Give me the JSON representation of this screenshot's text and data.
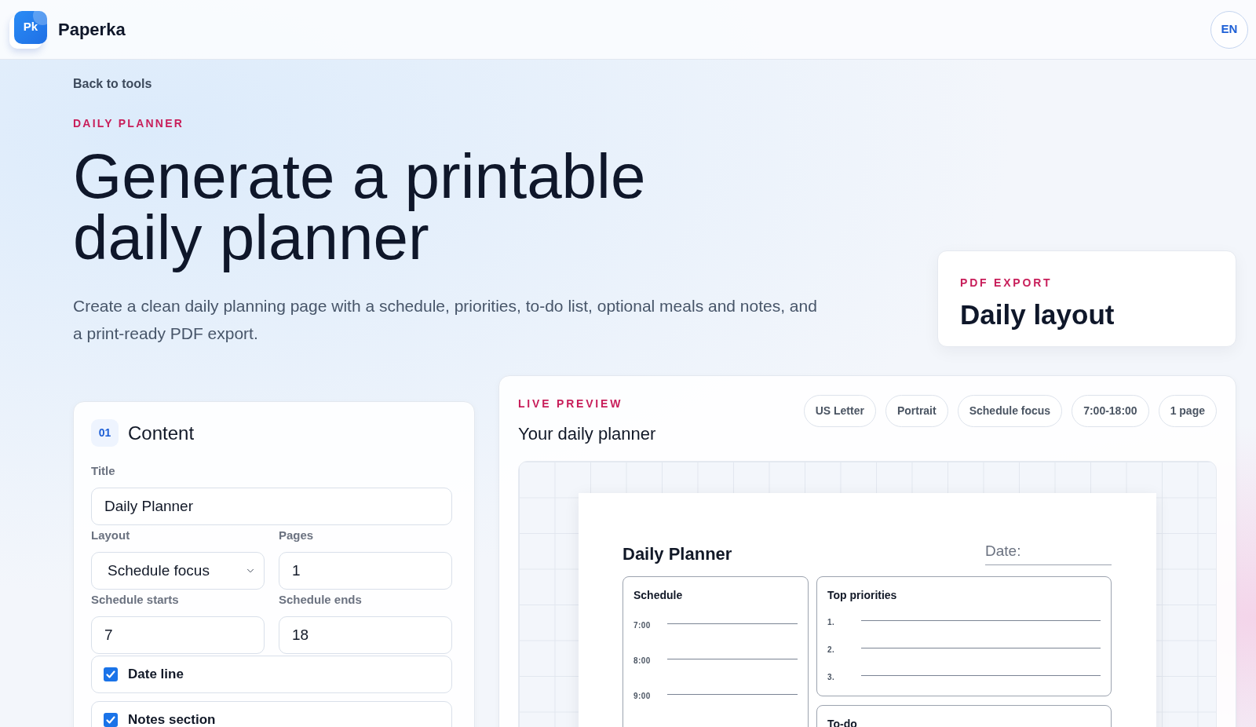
{
  "header": {
    "logo_text": "Pk",
    "brand": "Paperka",
    "language_button": "EN"
  },
  "hero": {
    "back_link": "Back to tools",
    "eyebrow": "DAILY PLANNER",
    "title": "Generate a printable daily planner",
    "description": "Create a clean daily planning page with a schedule, priorities, to-do list, optional meals and notes, and a print-ready PDF export."
  },
  "export_card": {
    "eyebrow": "PDF EXPORT",
    "title": "Daily layout"
  },
  "content_panel": {
    "step": "01",
    "title": "Content",
    "field_rows": [
      [
        {
          "kind": "text",
          "label": "Title",
          "value": "Daily Planner"
        }
      ],
      [
        {
          "kind": "select",
          "label": "Layout",
          "value": "Schedule focus"
        },
        {
          "kind": "number",
          "label": "Pages",
          "value": "1"
        }
      ],
      [
        {
          "kind": "number",
          "label": "Schedule starts",
          "value": "7"
        },
        {
          "kind": "number",
          "label": "Schedule ends",
          "value": "18"
        }
      ]
    ],
    "options": [
      {
        "label": "Date line",
        "checked": true
      },
      {
        "label": "Notes section",
        "checked": true
      }
    ]
  },
  "preview": {
    "eyebrow": "LIVE PREVIEW",
    "title": "Your daily planner",
    "tags": [
      "US Letter",
      "Portrait",
      "Schedule focus",
      "7:00-18:00",
      "1 page"
    ],
    "sheet": {
      "title": "Daily Planner",
      "date_label": "Date:",
      "columns": [
        [
          {
            "kind": "schedule",
            "title": "Schedule",
            "rows": [
              "7:00",
              "8:00",
              "9:00"
            ]
          }
        ],
        [
          {
            "kind": "numbered",
            "title": "Top priorities",
            "rows": [
              "1.",
              "2.",
              "3."
            ]
          },
          {
            "kind": "list",
            "title": "To-do"
          }
        ]
      ]
    }
  }
}
